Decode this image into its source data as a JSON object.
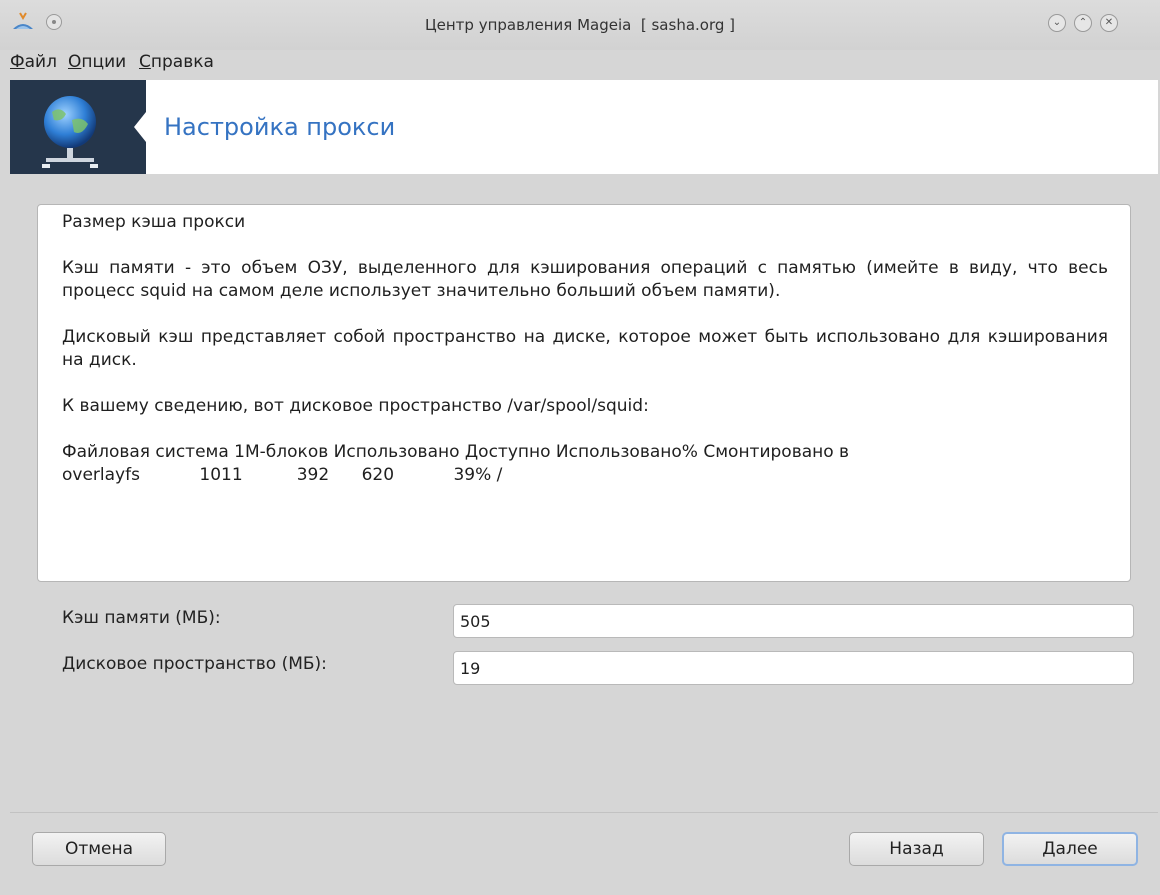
{
  "window": {
    "title": "Центр управления Mageia  [ sasha.org ]"
  },
  "menu": {
    "items": [
      "Файл",
      "Опции",
      "Справка"
    ]
  },
  "banner": {
    "title": "Настройка прокси",
    "icon": "globe-network-icon"
  },
  "info": {
    "heading": "Размер кэша прокси",
    "para_memory": "Кэш памяти - это объем ОЗУ, выделенного для кэширования операций с памятью (имейте в виду, что весь процесс squid на самом деле использует значительно больший объем памяти).",
    "para_disk": "Дисковый кэш представляет собой пространство на диске, которое может быть использовано для кэширования на диск.",
    "para_space": "К вашему сведению, вот дисковое пространство /var/spool/squid:",
    "df_header": "Файловая система 1M-блоков Использовано Доступно Использовано% Смонтировано в",
    "df_row": "overlayfs           1011          392      620           39% /"
  },
  "form": {
    "memory_label": "Кэш памяти (МБ):",
    "memory_value": "505",
    "disk_label": "Дисковое пространство (МБ):",
    "disk_value": "19"
  },
  "buttons": {
    "cancel": "Отмена",
    "back": "Назад",
    "next": "Далее"
  },
  "colors": {
    "banner_title": "#3573c2",
    "banner_dark": "#25364b",
    "default_button_border": "#8fb4e3"
  }
}
